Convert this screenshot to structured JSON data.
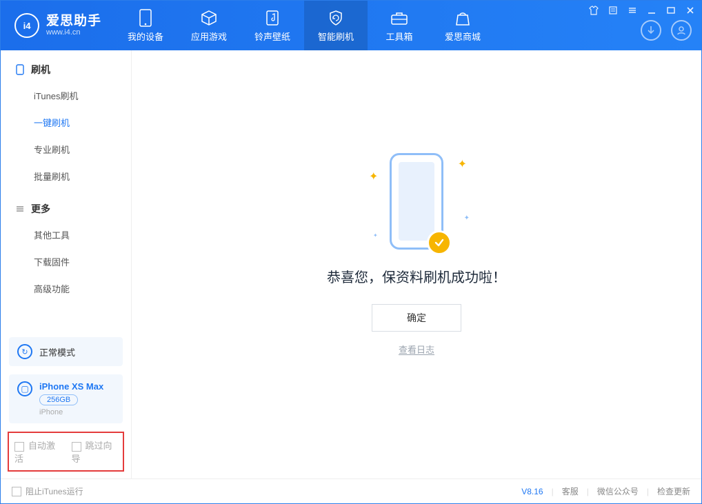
{
  "header": {
    "logo_title": "爱思助手",
    "logo_sub": "www.i4.cn",
    "logo_letter": "i4",
    "nav": [
      {
        "label": "我的设备"
      },
      {
        "label": "应用游戏"
      },
      {
        "label": "铃声壁纸"
      },
      {
        "label": "智能刷机"
      },
      {
        "label": "工具箱"
      },
      {
        "label": "爱思商城"
      }
    ]
  },
  "sidebar": {
    "section_flash": "刷机",
    "items_flash": [
      {
        "label": "iTunes刷机"
      },
      {
        "label": "一键刷机"
      },
      {
        "label": "专业刷机"
      },
      {
        "label": "批量刷机"
      }
    ],
    "section_more": "更多",
    "items_more": [
      {
        "label": "其他工具"
      },
      {
        "label": "下载固件"
      },
      {
        "label": "高级功能"
      }
    ],
    "mode_label": "正常模式",
    "device": {
      "name": "iPhone XS Max",
      "capacity": "256GB",
      "type": "iPhone"
    },
    "options": {
      "auto_activate": "自动激活",
      "skip_guide": "跳过向导"
    }
  },
  "main": {
    "success_text": "恭喜您，保资料刷机成功啦！",
    "ok_button": "确定",
    "log_link": "查看日志"
  },
  "footer": {
    "block_itunes": "阻止iTunes运行",
    "version": "V8.16",
    "link_support": "客服",
    "link_wechat": "微信公众号",
    "link_update": "检查更新"
  }
}
